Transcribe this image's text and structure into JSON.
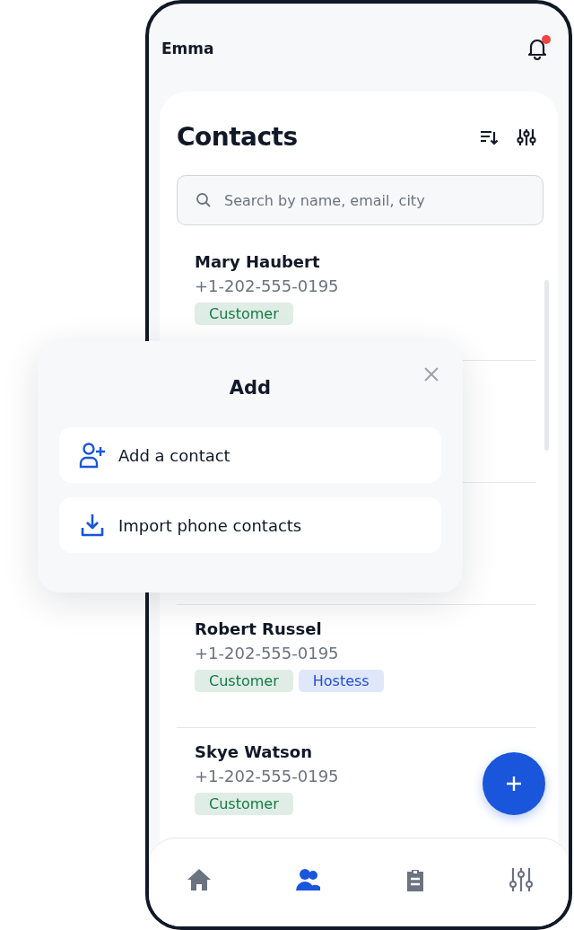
{
  "header": {
    "user": "Emma",
    "notification_dot": true
  },
  "title": "Contacts",
  "search": {
    "placeholder": "Search by name, email, city"
  },
  "contacts_top": [
    {
      "name": "Mary Haubert",
      "phone": "+1-202-555-0195",
      "tags": [
        {
          "label": "Customer",
          "color": "#137a44"
        }
      ]
    }
  ],
  "contacts_bottom": [
    {
      "name": "Robert Russel",
      "phone": "+1-202-555-0195",
      "tags": [
        {
          "label": "Customer",
          "color": "#137a44"
        },
        {
          "label": "Hostess",
          "color": "#1d4ed8"
        }
      ]
    },
    {
      "name": "Skye Watson",
      "phone": "+1-202-555-0195",
      "tags": [
        {
          "label": "Customer",
          "color": "#137a44"
        }
      ]
    }
  ],
  "add_dialog": {
    "title": "Add",
    "options": [
      {
        "kind": "contact",
        "label": "Add a contact"
      },
      {
        "kind": "import",
        "label": "Import phone contacts"
      }
    ]
  },
  "nav": [
    {
      "kind": "home",
      "selected": false
    },
    {
      "kind": "contacts",
      "selected": true
    },
    {
      "kind": "tasks",
      "selected": false
    },
    {
      "kind": "settings",
      "selected": false
    }
  ]
}
